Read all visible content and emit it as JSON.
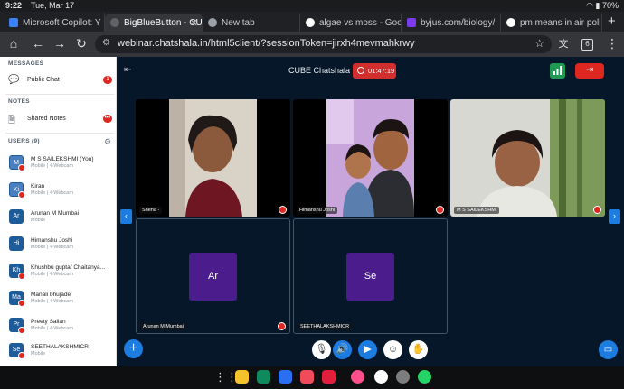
{
  "status": {
    "time": "9:22",
    "date": "Tue, Mar 17",
    "battery": "70%"
  },
  "tabs": [
    {
      "label": "Microsoft Copilot: Y",
      "color": "#3b82f6",
      "active": false
    },
    {
      "label": "BigBlueButton - CU",
      "color": "#5f6368",
      "active": true
    },
    {
      "label": "New tab",
      "color": "#9aa0a6",
      "active": false
    },
    {
      "label": "algae vs moss - Goo",
      "color": "#ffffff",
      "active": false
    },
    {
      "label": "byjus.com/biology/",
      "color": "#7c3aed",
      "active": false
    },
    {
      "label": "pm means in air poll",
      "color": "#ffffff",
      "active": false
    }
  ],
  "address": {
    "url": "webinar.chatshala.in/html5client/?sessionToken=jirxh4mevmahkrwy",
    "tab_count": "6"
  },
  "sidebar": {
    "messages_heading": "MESSAGES",
    "public_chat": "Public Chat",
    "public_chat_badge": "1",
    "notes_heading": "NOTES",
    "shared_notes": "Shared Notes",
    "shared_notes_badge": "•••",
    "users_heading": "USERS (9)",
    "users": [
      {
        "initials": "M",
        "name": "M S SAILEKSHMI (You)",
        "sub": "Mobile | ✈Webcam",
        "voice": true
      },
      {
        "initials": "Ki",
        "name": "Kiran",
        "sub": "Mobile | ✈Webcam",
        "voice": true
      },
      {
        "initials": "Ar",
        "name": "Arunan M Mumbai",
        "sub": "Mobile",
        "voice": false
      },
      {
        "initials": "Hi",
        "name": "Himanshu Joshi",
        "sub": "Mobile | ✈Webcam",
        "voice": false
      },
      {
        "initials": "Kh",
        "name": "Khushbu gupta/ Chaitanya...",
        "sub": "Mobile | ✈Webcam",
        "voice": false
      },
      {
        "initials": "Ma",
        "name": "Manali bhujade",
        "sub": "Mobile | ✈Webcam",
        "voice": false
      },
      {
        "initials": "Pr",
        "name": "Preety Salian",
        "sub": "Mobile | ✈Webcam",
        "voice": false
      },
      {
        "initials": "Se",
        "name": "SEETHALAKSHMICR",
        "sub": "Mobile",
        "voice": false
      }
    ]
  },
  "meeting": {
    "room_name": "CUBE Chatshala",
    "recording_time": "01:47:19",
    "tiles": [
      {
        "name": "Sneha -",
        "type": "video"
      },
      {
        "name": "Himanshu Joshi",
        "type": "video"
      },
      {
        "name": "M S SAILEKSHMI",
        "type": "video"
      },
      {
        "name": "Arunan M Mumbai",
        "type": "avatar",
        "initials": "Ar"
      },
      {
        "name": "SEETHALAKSHMICR",
        "type": "avatar",
        "initials": "Se"
      }
    ]
  },
  "colors": {
    "accent": "#1c7ce0",
    "danger": "#df2721",
    "avatar_purple": "#4b1d8c",
    "meeting_bg": "#06172a"
  }
}
